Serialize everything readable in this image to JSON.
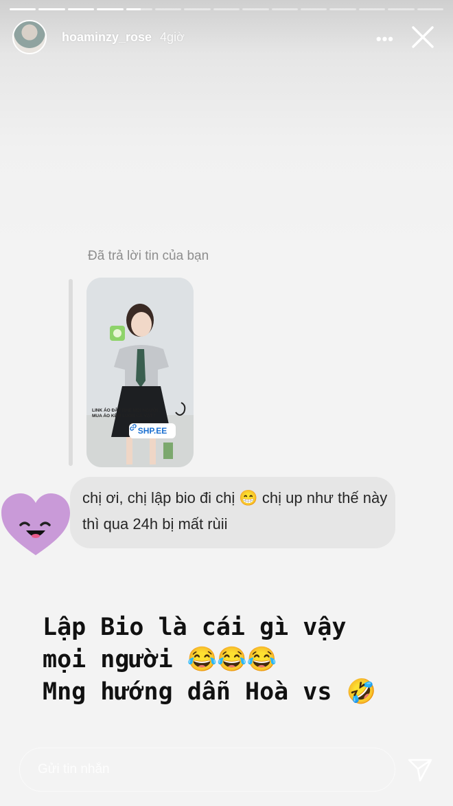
{
  "story": {
    "progress": [
      1,
      1,
      1,
      1,
      0.55,
      0,
      0,
      0,
      0,
      0,
      0,
      0,
      0,
      0,
      0
    ]
  },
  "header": {
    "username": "hoaminzy_rose",
    "time": "4giờ",
    "more_icon": "more-dots-icon",
    "close_icon": "close-icon"
  },
  "reply": {
    "label": "Đã trả lời tin của bạn",
    "thumbnail": {
      "caption": "LINK ÁO ĐÂY NHÉ MỌI NGƯỜI . MUA ÁO KÈM LUÔN CÀ VẠT !",
      "link": "SHP.EE"
    },
    "message": "chị ơi, chị lập bio đi chị 😁 chị up như thế này thì qua 24h bị mất rùii"
  },
  "caption": {
    "line1": "Lập Bio là cái gì vậy",
    "line2": "mọi người 😂😂😂",
    "line3": "Mng hướng dẫn Hoà vs 🤣"
  },
  "footer": {
    "placeholder": "Gửi tin nhắn",
    "send_icon": "send-icon"
  },
  "colors": {
    "bubble": "#e6e6e6",
    "sticker_heart": "#c99ad8",
    "emoji": "#ffcc33"
  }
}
